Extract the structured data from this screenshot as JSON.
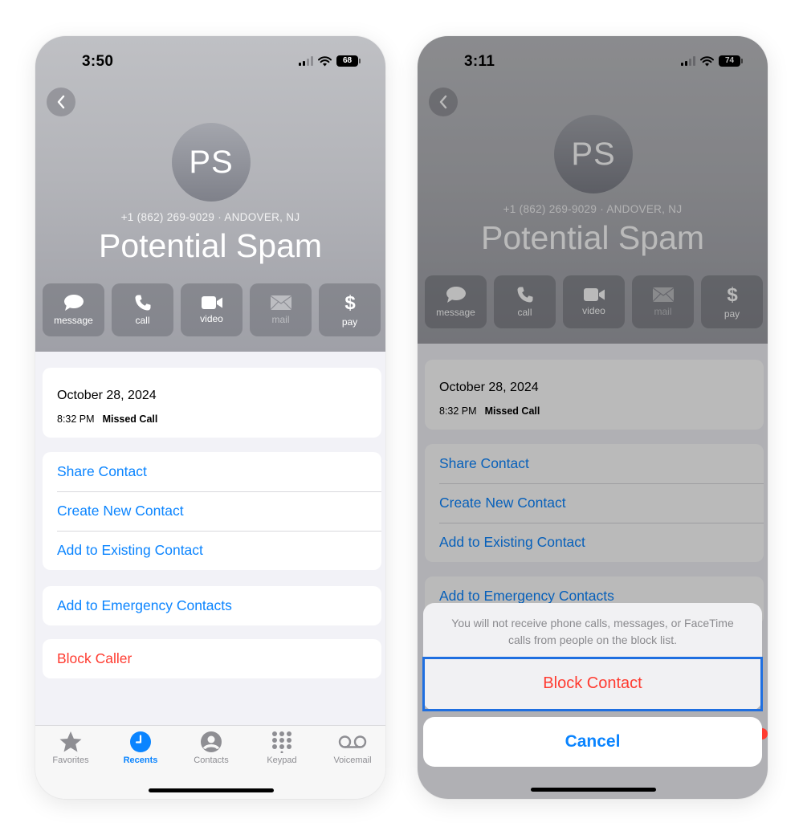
{
  "left": {
    "status": {
      "time": "3:50",
      "battery": "68"
    },
    "caller": {
      "initials": "PS",
      "subtitle": "+1 (862) 269-9029 · ANDOVER, NJ",
      "name": "Potential Spam"
    },
    "actions": [
      {
        "label": "message",
        "icon": "message-icon",
        "enabled": true
      },
      {
        "label": "call",
        "icon": "phone-icon",
        "enabled": true
      },
      {
        "label": "video",
        "icon": "video-icon",
        "enabled": true
      },
      {
        "label": "mail",
        "icon": "mail-icon",
        "enabled": false
      },
      {
        "label": "pay",
        "icon": "dollar-icon",
        "enabled": true
      }
    ],
    "call_log": {
      "date": "October 28, 2024",
      "time": "8:32 PM",
      "type": "Missed Call"
    },
    "menu": [
      "Share Contact",
      "Create New Contact",
      "Add to Existing Contact"
    ],
    "emergency": "Add to Emergency Contacts",
    "block": "Block Caller",
    "tabs": [
      {
        "label": "Favorites",
        "icon": "star-icon"
      },
      {
        "label": "Recents",
        "icon": "clock-icon",
        "active": true
      },
      {
        "label": "Contacts",
        "icon": "person-icon"
      },
      {
        "label": "Keypad",
        "icon": "keypad-icon"
      },
      {
        "label": "Voicemail",
        "icon": "voicemail-icon"
      }
    ]
  },
  "right": {
    "status": {
      "time": "3:11",
      "battery": "74"
    },
    "caller": {
      "initials": "PS",
      "subtitle": "+1 (862) 269-9029 · ANDOVER, NJ",
      "name": "Potential Spam"
    },
    "actions": [
      {
        "label": "message",
        "icon": "message-icon",
        "enabled": true
      },
      {
        "label": "call",
        "icon": "phone-icon",
        "enabled": true
      },
      {
        "label": "video",
        "icon": "video-icon",
        "enabled": true
      },
      {
        "label": "mail",
        "icon": "mail-icon",
        "enabled": false
      },
      {
        "label": "pay",
        "icon": "dollar-icon",
        "enabled": true
      }
    ],
    "call_log": {
      "date": "October 28, 2024",
      "time": "8:32 PM",
      "type": "Missed Call"
    },
    "menu": [
      "Share Contact",
      "Create New Contact",
      "Add to Existing Contact"
    ],
    "emergency": "Add to Emergency Contacts",
    "sheet": {
      "message": "You will not receive phone calls, messages, or FaceTime calls from people on the block list.",
      "confirm": "Block Contact",
      "cancel": "Cancel"
    }
  },
  "colors": {
    "accent": "#0a84ff",
    "destructive": "#ff3b30",
    "highlight": "#1f6fe0"
  }
}
